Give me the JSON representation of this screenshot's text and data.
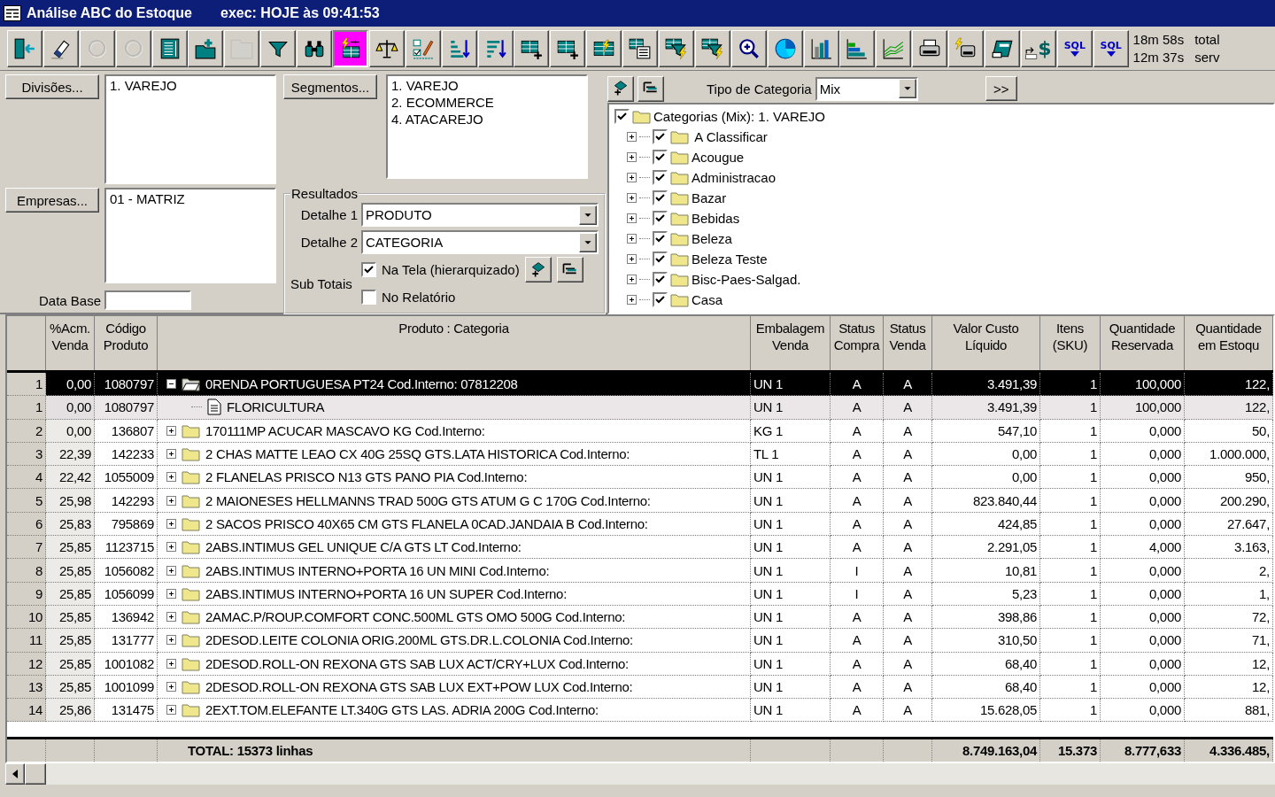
{
  "window": {
    "title": "Análise ABC do Estoque",
    "exec": "exec: HOJE às 09:41:53"
  },
  "toolbar": [
    {
      "kind": "exit",
      "disabled": false,
      "selected": false
    },
    {
      "kind": "eraser",
      "disabled": false,
      "selected": false
    },
    {
      "kind": "ring",
      "disabled": true,
      "selected": false
    },
    {
      "kind": "ring",
      "disabled": true,
      "selected": false
    },
    {
      "kind": "sheet",
      "disabled": false,
      "selected": false
    },
    {
      "kind": "folder-plus",
      "disabled": false,
      "selected": false
    },
    {
      "kind": "folder",
      "disabled": true,
      "selected": false
    },
    {
      "kind": "filter",
      "disabled": false,
      "selected": false
    },
    {
      "kind": "binoculars",
      "disabled": false,
      "selected": false
    },
    {
      "kind": "lightning-grid",
      "disabled": false,
      "selected": true
    },
    {
      "kind": "scales",
      "disabled": false,
      "selected": false
    },
    {
      "kind": "checklist",
      "disabled": false,
      "selected": false
    },
    {
      "kind": "sort-asc",
      "disabled": false,
      "selected": false
    },
    {
      "kind": "sort-desc",
      "disabled": false,
      "selected": false
    },
    {
      "kind": "grid-plus",
      "disabled": false,
      "selected": false
    },
    {
      "kind": "grid-plus",
      "disabled": false,
      "selected": false
    },
    {
      "kind": "grid-lightning",
      "disabled": false,
      "selected": false
    },
    {
      "kind": "grid-list",
      "disabled": false,
      "selected": false
    },
    {
      "kind": "filter-lightning",
      "disabled": false,
      "selected": false
    },
    {
      "kind": "filter-lightning",
      "disabled": false,
      "selected": false
    },
    {
      "kind": "zoom",
      "disabled": false,
      "selected": false
    },
    {
      "kind": "pie",
      "disabled": false,
      "selected": false
    },
    {
      "kind": "bar",
      "disabled": false,
      "selected": false
    },
    {
      "kind": "steps",
      "disabled": false,
      "selected": false
    },
    {
      "kind": "line",
      "disabled": false,
      "selected": false
    },
    {
      "kind": "printer",
      "disabled": false,
      "selected": false
    },
    {
      "kind": "printer-lightning",
      "disabled": false,
      "selected": false
    },
    {
      "kind": "card",
      "disabled": false,
      "selected": false
    },
    {
      "kind": "money",
      "label": "$",
      "disabled": false,
      "selected": false
    },
    {
      "kind": "sql",
      "label": "SQL",
      "disabled": false,
      "selected": false
    },
    {
      "kind": "sql",
      "label": "SQL",
      "disabled": false,
      "selected": false
    }
  ],
  "timers": [
    {
      "time": "18m 58s",
      "label": "total"
    },
    {
      "time": "12m 37s",
      "label": "serv"
    }
  ],
  "filters": {
    "divisions": {
      "button": "Divisões...",
      "items": [
        "1. VAREJO"
      ]
    },
    "companies": {
      "button": "Empresas...",
      "items": [
        "01 - MATRIZ"
      ]
    },
    "base_date": {
      "label": "Data Base"
    },
    "segments": {
      "button": "Segmentos...",
      "items": [
        "1. VAREJO",
        "2. ECOMMERCE",
        "4. ATACAREJO"
      ]
    },
    "results": {
      "title": "Resultados",
      "detail_1": {
        "label": "Detalhe 1",
        "value": "PRODUTO"
      },
      "detail_2": {
        "label": "Detalhe 2",
        "value": "CATEGORIA"
      },
      "subtotals_label": "Sub Totais",
      "options": [
        {
          "label": "Na Tela (hierarquizado)",
          "checked": true
        },
        {
          "label": "No Relatório",
          "checked": false
        }
      ]
    }
  },
  "categories": {
    "type_label": "Tipo de Categoria",
    "type_value": "Mix",
    "more_button": ">>",
    "tree": {
      "label": "Categorias (Mix): 1. VAREJO",
      "checked": true,
      "children": [
        {
          "label": " A Classificar",
          "checked": true,
          "expanded": false
        },
        {
          "label": "Acougue",
          "checked": true,
          "expanded": false
        },
        {
          "label": "Administracao",
          "checked": true,
          "expanded": false
        },
        {
          "label": "Bazar",
          "checked": true,
          "expanded": false
        },
        {
          "label": "Bebidas",
          "checked": true,
          "expanded": false
        },
        {
          "label": "Beleza",
          "checked": true,
          "expanded": false
        },
        {
          "label": "Beleza Teste",
          "checked": true,
          "expanded": false
        },
        {
          "label": "Bisc-Paes-Salgad.",
          "checked": true,
          "expanded": false
        },
        {
          "label": "Casa",
          "checked": true,
          "expanded": false
        }
      ]
    }
  },
  "table": {
    "columns": [
      {
        "lines": [
          "%Acm.",
          "Venda"
        ]
      },
      {
        "lines": [
          "Código",
          "Produto"
        ]
      },
      {
        "lines": [
          "Produto : Categoria"
        ]
      },
      {
        "lines": [
          "Embalagem",
          "Venda"
        ]
      },
      {
        "lines": [
          "Status",
          "Compra"
        ]
      },
      {
        "lines": [
          "Status",
          "Venda"
        ]
      },
      {
        "lines": [
          "Valor Custo",
          "Líquido"
        ]
      },
      {
        "lines": [
          "Itens",
          "(SKU)"
        ]
      },
      {
        "lines": [
          "Quantidade",
          "Reservada"
        ]
      },
      {
        "lines": [
          "Quantidade",
          "em Estoqu"
        ]
      }
    ],
    "rows": [
      {
        "num": "1",
        "acm": "0,00",
        "code": "1080797",
        "product": "0RENDA PORTUGUESA PT24 Cod.Interno: 07812208",
        "pack": "UN 1",
        "buy": "A",
        "sell": "A",
        "cost": "3.491,39",
        "items": "1",
        "reserved": "100,000",
        "stock": "122,",
        "selected": true,
        "expanded": true,
        "children": [
          {
            "num": "1",
            "acm": "0,00",
            "code": "1080797",
            "product": "FLORICULTURA",
            "pack": "UN 1",
            "buy": "A",
            "sell": "A",
            "cost": "3.491,39",
            "items": "1",
            "reserved": "100,000",
            "stock": "122,",
            "selected": false
          }
        ]
      },
      {
        "num": "2",
        "acm": "0,00",
        "code": "136807",
        "product": "170111MP ACUCAR MASCAVO KG Cod.Interno:",
        "pack": "KG 1",
        "buy": "A",
        "sell": "A",
        "cost": "547,10",
        "items": "1",
        "reserved": "0,000",
        "stock": "50,",
        "selected": false,
        "expanded": false
      },
      {
        "num": "3",
        "acm": "22,39",
        "code": "142233",
        "product": "2 CHAS MATTE LEAO CX 40G 25SQ GTS.LATA HISTORICA Cod.Interno:",
        "pack": "TL 1",
        "buy": "A",
        "sell": "A",
        "cost": "0,00",
        "items": "1",
        "reserved": "0,000",
        "stock": "1.000.000,",
        "selected": false,
        "expanded": false
      },
      {
        "num": "4",
        "acm": "22,42",
        "code": "1055009",
        "product": "2 FLANELAS PRISCO N13 GTS PANO PIA Cod.Interno:",
        "pack": "UN 1",
        "buy": "A",
        "sell": "A",
        "cost": "0,00",
        "items": "1",
        "reserved": "0,000",
        "stock": "950,",
        "selected": false,
        "expanded": false
      },
      {
        "num": "5",
        "acm": "25,98",
        "code": "142293",
        "product": "2 MAIONESES HELLMANNS TRAD 500G GTS ATUM G C 170G Cod.Interno:",
        "pack": "UN 1",
        "buy": "A",
        "sell": "A",
        "cost": "823.840,44",
        "items": "1",
        "reserved": "0,000",
        "stock": "200.290,",
        "selected": false,
        "expanded": false
      },
      {
        "num": "6",
        "acm": "25,83",
        "code": "795869",
        "product": "2 SACOS PRISCO 40X65 CM GTS FLANELA 0CAD.JANDAIA B Cod.Interno:",
        "pack": "UN 1",
        "buy": "A",
        "sell": "A",
        "cost": "424,85",
        "items": "1",
        "reserved": "0,000",
        "stock": "27.647,",
        "selected": false,
        "expanded": false
      },
      {
        "num": "7",
        "acm": "25,85",
        "code": "1123715",
        "product": "2ABS.INTIMUS GEL UNIQUE C/A GTS LT Cod.Interno:",
        "pack": "UN 1",
        "buy": "A",
        "sell": "A",
        "cost": "2.291,05",
        "items": "1",
        "reserved": "4,000",
        "stock": "3.163,",
        "selected": false,
        "expanded": false
      },
      {
        "num": "8",
        "acm": "25,85",
        "code": "1056082",
        "product": "2ABS.INTIMUS INTERNO+PORTA 16 UN MINI Cod.Interno:",
        "pack": "UN 1",
        "buy": "I",
        "sell": "A",
        "cost": "10,81",
        "items": "1",
        "reserved": "0,000",
        "stock": "2,",
        "selected": false,
        "expanded": false
      },
      {
        "num": "9",
        "acm": "25,85",
        "code": "1056099",
        "product": "2ABS.INTIMUS INTERNO+PORTA 16 UN SUPER Cod.Interno:",
        "pack": "UN 1",
        "buy": "I",
        "sell": "A",
        "cost": "5,23",
        "items": "1",
        "reserved": "0,000",
        "stock": "1,",
        "selected": false,
        "expanded": false
      },
      {
        "num": "10",
        "acm": "25,85",
        "code": "136942",
        "product": "2AMAC.P/ROUP.COMFORT CONC.500ML GTS OMO 500G Cod.Interno:",
        "pack": "UN 1",
        "buy": "A",
        "sell": "A",
        "cost": "398,86",
        "items": "1",
        "reserved": "0,000",
        "stock": "72,",
        "selected": false,
        "expanded": false
      },
      {
        "num": "11",
        "acm": "25,85",
        "code": "131777",
        "product": "2DESOD.LEITE COLONIA ORIG.200ML GTS.DR.L.COLONIA Cod.Interno:",
        "pack": "UN 1",
        "buy": "A",
        "sell": "A",
        "cost": "310,50",
        "items": "1",
        "reserved": "0,000",
        "stock": "71,",
        "selected": false,
        "expanded": false
      },
      {
        "num": "12",
        "acm": "25,85",
        "code": "1001082",
        "product": "2DESOD.ROLL-ON REXONA GTS SAB LUX ACT/CRY+LUX Cod.Interno:",
        "pack": "UN 1",
        "buy": "A",
        "sell": "A",
        "cost": "68,40",
        "items": "1",
        "reserved": "0,000",
        "stock": "12,",
        "selected": false,
        "expanded": false
      },
      {
        "num": "13",
        "acm": "25,85",
        "code": "1001099",
        "product": "2DESOD.ROLL-ON REXONA GTS SAB LUX EXT+POW LUX Cod.Interno:",
        "pack": "UN 1",
        "buy": "A",
        "sell": "A",
        "cost": "68,40",
        "items": "1",
        "reserved": "0,000",
        "stock": "12,",
        "selected": false,
        "expanded": false
      },
      {
        "num": "14",
        "acm": "25,86",
        "code": "131475",
        "product": "2EXT.TOM.ELEFANTE LT.340G GTS LAS. ADRIA 200G Cod.Interno:",
        "pack": "UN 1",
        "buy": "A",
        "sell": "A",
        "cost": "15.628,05",
        "items": "1",
        "reserved": "0,000",
        "stock": "881,",
        "selected": false,
        "expanded": false
      }
    ],
    "total": {
      "label": "TOTAL: 15373 linhas",
      "cost": "8.749.163,04",
      "items": "15.373",
      "reserved": "8.777,633",
      "stock": "4.336.485,"
    }
  }
}
